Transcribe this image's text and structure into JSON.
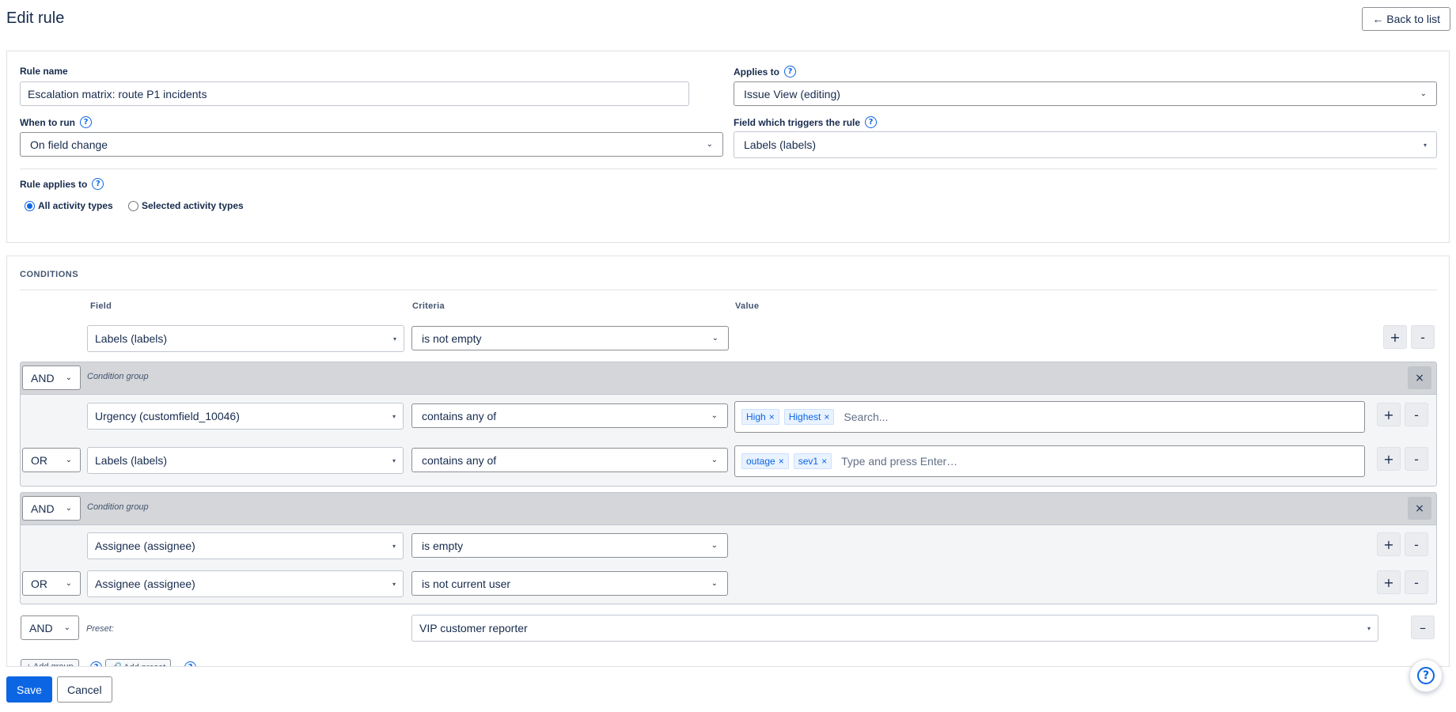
{
  "header": {
    "title": "Edit rule",
    "back_label": "← Back to list"
  },
  "general": {
    "rule_name_label": "Rule name",
    "rule_name_value": "Escalation matrix: route P1 incidents",
    "applies_to_label": "Applies to",
    "applies_to_value": "Issue View (editing)",
    "when_label": "When to run",
    "when_value": "On field change",
    "trigger_label": "Field which triggers the rule",
    "trigger_value": "Labels (labels)",
    "rule_applies_label": "Rule applies to",
    "radio_all": "All activity types",
    "radio_selected": "Selected activity types",
    "help_glyph": "?"
  },
  "conditions": {
    "title": "CONDITIONS",
    "col_field": "Field",
    "col_criteria": "Criteria",
    "col_value": "Value",
    "top_row": {
      "field": "Labels (labels)",
      "criteria": "is not empty"
    },
    "group_label": "Condition group",
    "groups": [
      {
        "op": "AND",
        "rows": [
          {
            "op": "",
            "field": "Urgency (customfield_10046)",
            "criteria": "contains any of",
            "tags": [
              "High",
              "Highest"
            ],
            "placeholder": "Search..."
          },
          {
            "op": "OR",
            "field": "Labels (labels)",
            "criteria": "contains any of",
            "tags": [
              "outage",
              "sev1"
            ],
            "placeholder": "Type and press Enter…"
          }
        ]
      },
      {
        "op": "AND",
        "rows": [
          {
            "op": "",
            "field": "Assignee (assignee)",
            "criteria": "is empty"
          },
          {
            "op": "OR",
            "field": "Assignee (assignee)",
            "criteria": "is not current user"
          }
        ]
      }
    ],
    "preset": {
      "op": "AND",
      "label": "Preset:",
      "value": "VIP customer reporter"
    },
    "add_group_label": "+ Add group",
    "add_preset_label": "🔗 Add preset"
  },
  "footer": {
    "save_label": "Save",
    "cancel_label": "Cancel"
  },
  "icons": {
    "plus": "+",
    "minus": "-",
    "dash": "–",
    "close": "×",
    "chevron": "⌄",
    "caret": "▾",
    "help": "?"
  }
}
